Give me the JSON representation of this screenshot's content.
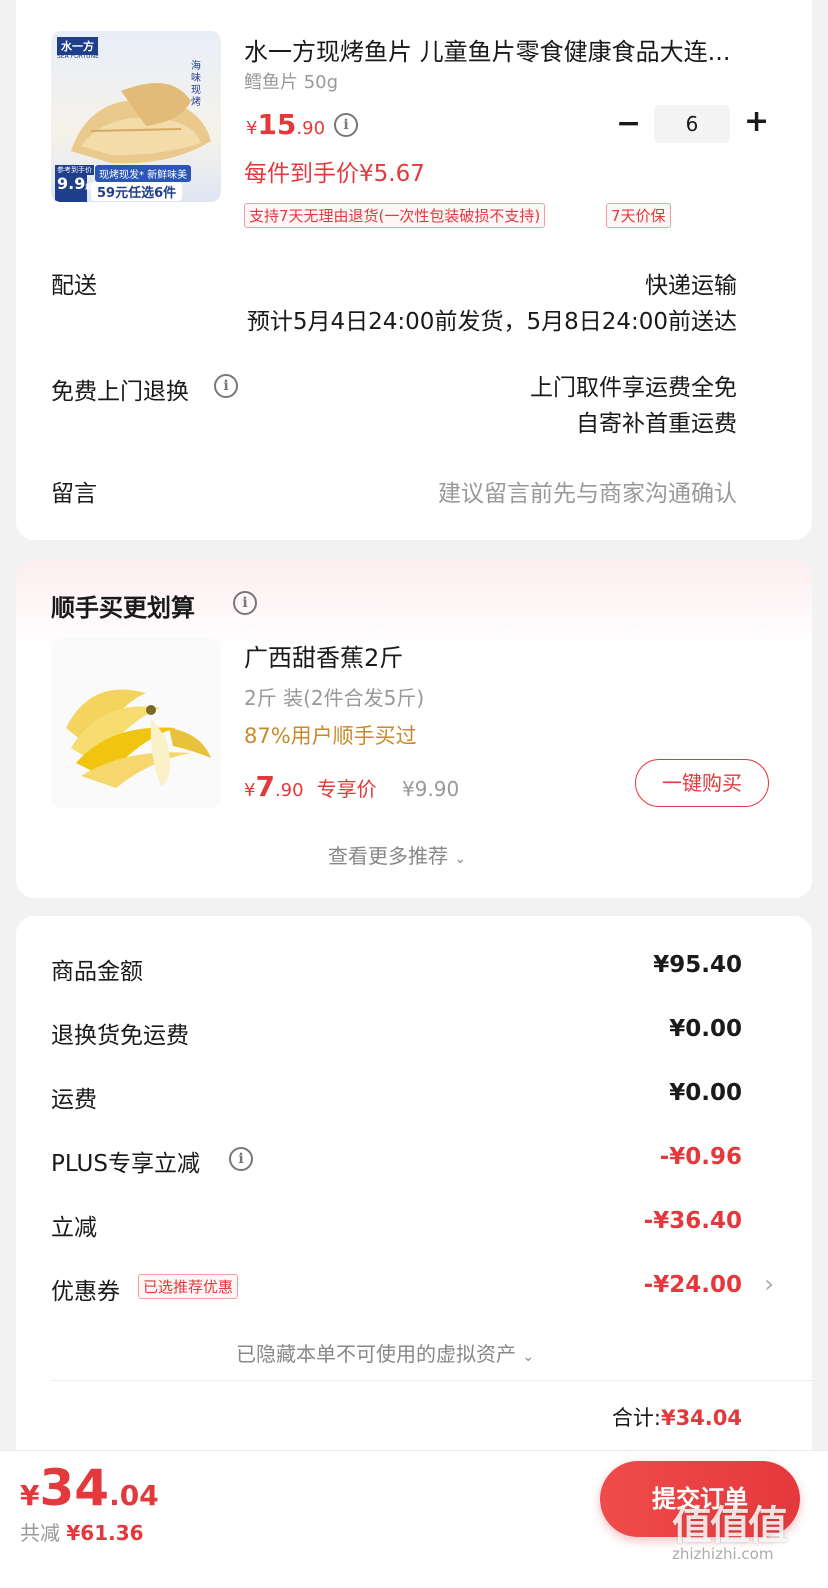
{
  "product": {
    "title": "水一方现烤鱼片 儿童鱼片零食健康食品大连...",
    "spec": "鳕鱼片 50g",
    "price_currency": "¥",
    "price_int": "15",
    "price_dec": ".90",
    "unit_price": "每件到手价¥5.67",
    "quantity": "6",
    "minus_label": "−",
    "plus_label": "+",
    "tags": [
      "支持7天无理由退货(一次性包装破损不支持)",
      "7天价保"
    ],
    "image": {
      "brand": "水一方",
      "brand_sub": "SEA FORTUNE",
      "side_text": "海味现烤",
      "price_ref_label": "参考到手价",
      "price_ref": "9.9",
      "price_ref_unit": "起",
      "banner_line1": "现烤现发* 新鲜味美",
      "banner_line2": "59元任选6件"
    }
  },
  "delivery": {
    "label": "配送",
    "method": "快递运输",
    "estimate": "预计5月4日24:00前发货，5月8日24:00前送达"
  },
  "return_service": {
    "label": "免费上门退换",
    "line1": "上门取件享运费全免",
    "line2": "自寄补首重运费"
  },
  "message": {
    "label": "留言",
    "placeholder": "建议留言前先与商家沟通确认"
  },
  "addon": {
    "section_title": "顺手买更划算",
    "title": "广西甜香蕉2斤",
    "spec": "2斤 装(2件合发5斤)",
    "bought": "87%用户顺手买过",
    "price_currency": "¥",
    "price_int": "7",
    "price_dec": ".90",
    "price_label": "专享价",
    "orig_price": "¥9.90",
    "buy_button": "一键购买",
    "more": "查看更多推荐"
  },
  "summary": {
    "rows": [
      {
        "label": "商品金额",
        "value": "¥95.40"
      },
      {
        "label": "退换货免运费",
        "value": "¥0.00"
      },
      {
        "label": "运费",
        "value": "¥0.00"
      },
      {
        "label": "PLUS专享立减",
        "value": "-¥0.96"
      },
      {
        "label": "立减",
        "value": "-¥36.40"
      },
      {
        "label": "优惠券",
        "value": "-¥24.00"
      }
    ],
    "coupon_tag": "已选推荐优惠",
    "hidden_assets": "已隐藏本单不可使用的虚拟资产",
    "total_label": "合计:",
    "total_value": "¥34.04"
  },
  "footer": {
    "currency": "¥",
    "total_int": "34",
    "total_dec": ".04",
    "saved_label": "共减",
    "saved_value": "¥61.36",
    "submit": "提交订单"
  },
  "watermark": {
    "logo": "值值值",
    "url": "zhizhizhi.com"
  },
  "colors": {
    "accent": "#e4393c",
    "orange": "#c98a2a",
    "background": "#f2f2f2"
  }
}
